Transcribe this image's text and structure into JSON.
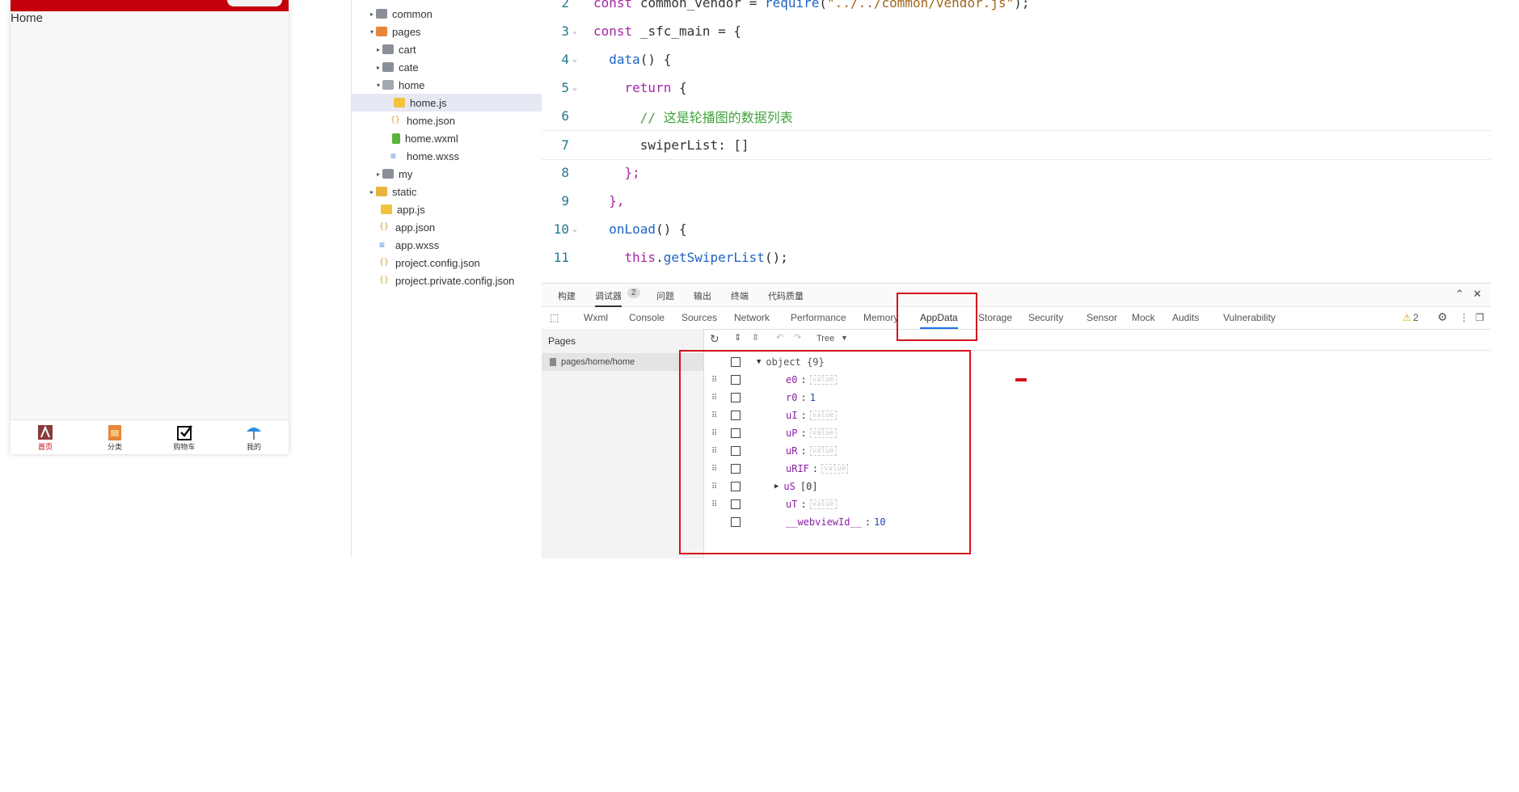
{
  "phone": {
    "title": "Home",
    "tabs": [
      {
        "label": "首页",
        "icon": "home-tab-icon",
        "active": true
      },
      {
        "label": "分类",
        "icon": "category-tab-icon",
        "active": false
      },
      {
        "label": "购物车",
        "icon": "cart-tab-icon",
        "active": false
      },
      {
        "label": "我的",
        "icon": "my-tab-icon",
        "active": false
      }
    ]
  },
  "filetree": [
    {
      "label": "common",
      "type": "folder",
      "expanded": false
    },
    {
      "label": "pages",
      "type": "folder",
      "expanded": true
    },
    {
      "label": "cart",
      "type": "folder",
      "expanded": false
    },
    {
      "label": "cate",
      "type": "folder",
      "expanded": false
    },
    {
      "label": "home",
      "type": "folder",
      "expanded": true
    },
    {
      "label": "home.js",
      "type": "js",
      "selected": true
    },
    {
      "label": "home.json",
      "type": "json"
    },
    {
      "label": "home.wxml",
      "type": "wxml"
    },
    {
      "label": "home.wxss",
      "type": "wxss"
    },
    {
      "label": "my",
      "type": "folder",
      "expanded": false
    },
    {
      "label": "static",
      "type": "folder",
      "expanded": false
    },
    {
      "label": "app.js",
      "type": "js"
    },
    {
      "label": "app.json",
      "type": "json"
    },
    {
      "label": "app.wxss",
      "type": "wxss"
    },
    {
      "label": "project.config.json",
      "type": "json"
    },
    {
      "label": "project.private.config.json",
      "type": "json"
    }
  ],
  "editor": {
    "lines": [
      {
        "n": "2",
        "text": "const common_vendor = require(\"../../common/vendor.js\");"
      },
      {
        "n": "3",
        "text": "const _sfc_main = {"
      },
      {
        "n": "4",
        "text": "  data() {"
      },
      {
        "n": "5",
        "text": "    return {"
      },
      {
        "n": "6",
        "text": "      // 这是轮播图的数据列表"
      },
      {
        "n": "7",
        "text": "      swiperList: []"
      },
      {
        "n": "8",
        "text": "    };"
      },
      {
        "n": "9",
        "text": "  },"
      },
      {
        "n": "10",
        "text": "  onLoad() {"
      },
      {
        "n": "11",
        "text": "    this.getSwiperList();"
      }
    ]
  },
  "devtools": {
    "top_tabs": [
      "构建",
      "调试器",
      "问题",
      "输出",
      "终端",
      "代码质量"
    ],
    "debugger_badge": "2",
    "tabs": [
      "Wxml",
      "Console",
      "Sources",
      "Network",
      "Performance",
      "Memory",
      "AppData",
      "Storage",
      "Security",
      "Sensor",
      "Mock",
      "Audits",
      "Vulnerability"
    ],
    "active_tab": "AppData",
    "warning_count": "2",
    "pages_header": "Pages",
    "page_item": "pages/home/home",
    "view_mode": "Tree",
    "object_label": "object {9}",
    "entries": [
      {
        "key": "e0",
        "value": "value",
        "placeholder": true
      },
      {
        "key": "r0",
        "value": "1",
        "placeholder": false
      },
      {
        "key": "uI",
        "value": "value",
        "placeholder": true
      },
      {
        "key": "uP",
        "value": "value",
        "placeholder": true
      },
      {
        "key": "uR",
        "value": "value",
        "placeholder": true
      },
      {
        "key": "uRIF",
        "value": "value",
        "placeholder": true
      },
      {
        "key": "uS",
        "value": "[0]",
        "placeholder": false,
        "expandable": true
      },
      {
        "key": "uT",
        "value": "value",
        "placeholder": true
      },
      {
        "key": "__webviewId__",
        "value": "10",
        "placeholder": false
      }
    ]
  },
  "colors": {
    "brand_red": "#c4000a",
    "highlight_red": "#d2121b",
    "accent_blue": "#1a73e8"
  }
}
